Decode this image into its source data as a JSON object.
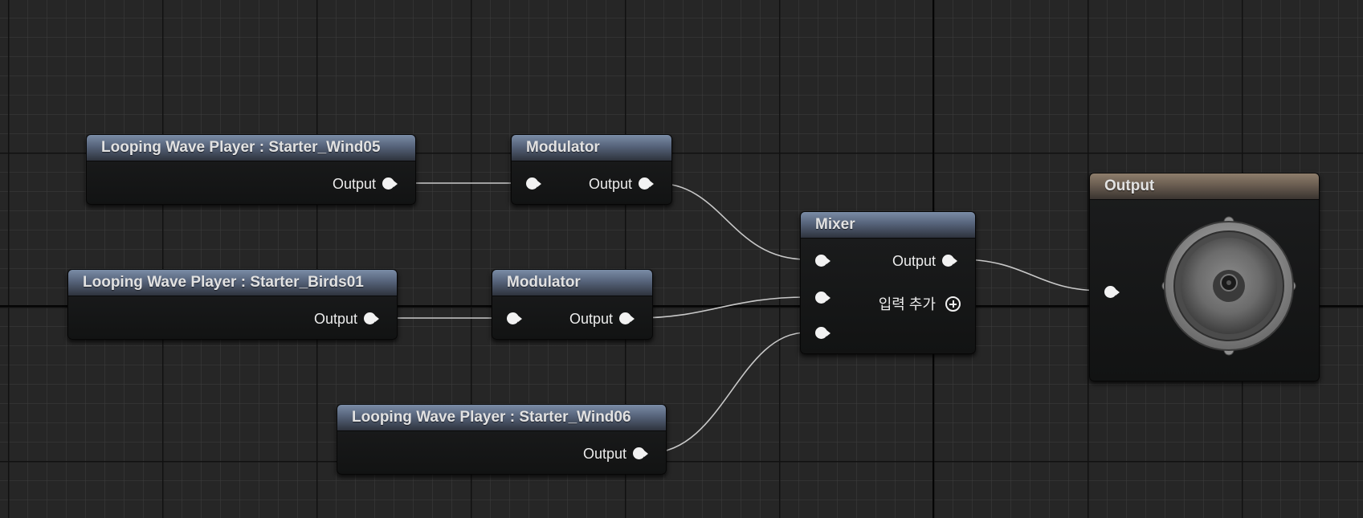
{
  "graph": {
    "nodes": {
      "wave_wind05": {
        "title": "Looping Wave Player : Starter_Wind05",
        "output_label": "Output"
      },
      "modulator_1": {
        "title": "Modulator",
        "output_label": "Output"
      },
      "wave_birds01": {
        "title": "Looping Wave Player : Starter_Birds01",
        "output_label": "Output"
      },
      "modulator_2": {
        "title": "Modulator",
        "output_label": "Output"
      },
      "wave_wind06": {
        "title": "Looping Wave Player : Starter_Wind06",
        "output_label": "Output"
      },
      "mixer": {
        "title": "Mixer",
        "output_label": "Output",
        "add_input_label": "입력 추가"
      },
      "output": {
        "title": "Output"
      }
    }
  },
  "colors": {
    "canvas_background": "#262626",
    "default_header": "#56637a",
    "output_header": "#6a5d51",
    "wire": "#bdbdbd"
  },
  "icons": [
    "pin-icon",
    "add-input-icon",
    "speaker-icon"
  ]
}
